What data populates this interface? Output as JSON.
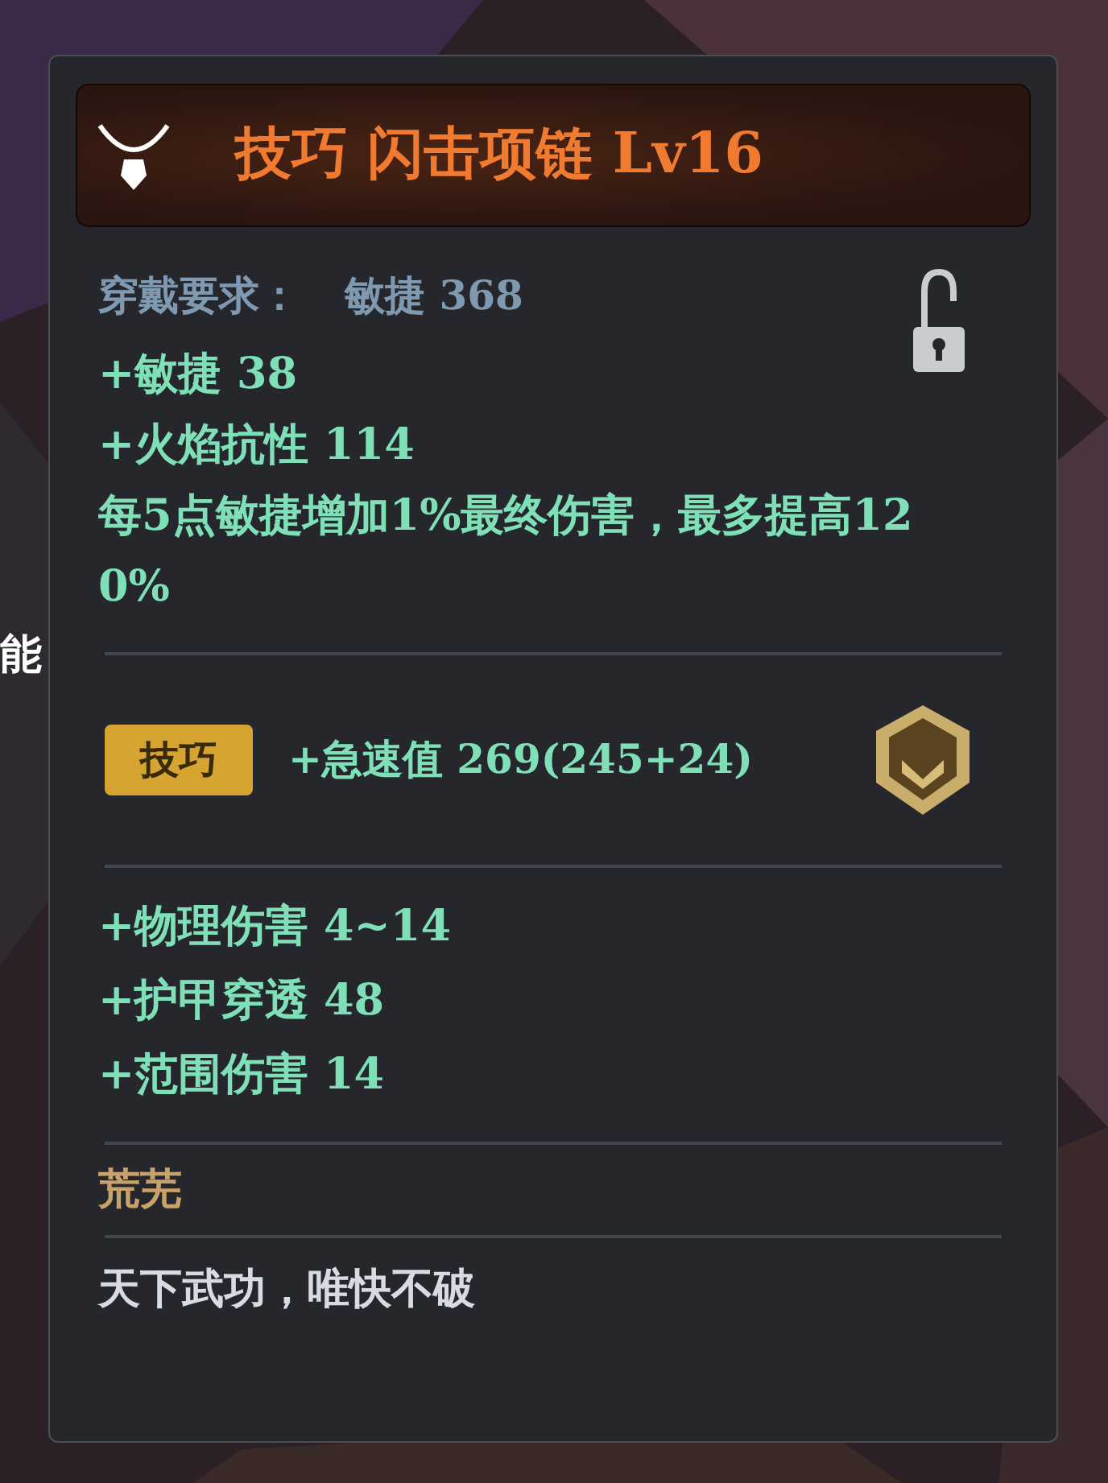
{
  "background_text": "能",
  "header": {
    "title": "技巧 闪击项链 Lv16"
  },
  "requirement": {
    "label": "穿戴要求：",
    "value": "敏捷 368",
    "locked": false
  },
  "base_stats": [
    "+敏捷 38",
    "+火焰抗性 114",
    "每5点敏捷增加1%最终伤害，最多提高120%"
  ],
  "affix": {
    "tag": "技巧",
    "text": "+急速值 269(245+24)"
  },
  "extra_stats": [
    "+物理伤害 4~14",
    "+护甲穿透 48",
    "+范围伤害 14"
  ],
  "set_name": "荒芜",
  "flavor": "天下武功，唯快不破"
}
